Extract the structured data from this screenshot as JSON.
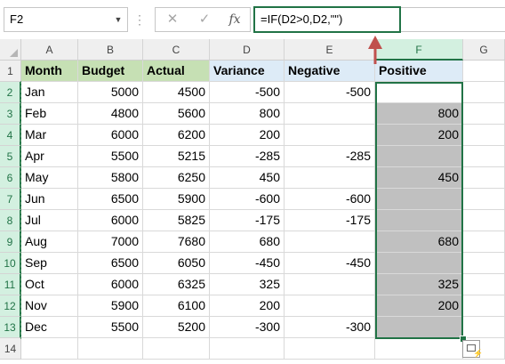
{
  "formula_bar": {
    "name_box": "F2",
    "cancel_glyph": "✕",
    "enter_glyph": "✓",
    "fx_label": "fx",
    "formula": "=IF(D2>0,D2,\"\")"
  },
  "columns": [
    "A",
    "B",
    "C",
    "D",
    "E",
    "F",
    "G"
  ],
  "selected_column": "F",
  "rows": [
    "1",
    "2",
    "3",
    "4",
    "5",
    "6",
    "7",
    "8",
    "9",
    "10",
    "11",
    "12",
    "13",
    "14"
  ],
  "headers": {
    "month": "Month",
    "budget": "Budget",
    "actual": "Actual",
    "variance": "Variance",
    "negative": "Negative",
    "positive": "Positive"
  },
  "table": [
    {
      "month": "Jan",
      "budget": "5000",
      "actual": "4500",
      "variance": "-500",
      "negative": "-500",
      "positive": ""
    },
    {
      "month": "Feb",
      "budget": "4800",
      "actual": "5600",
      "variance": "800",
      "negative": "",
      "positive": "800"
    },
    {
      "month": "Mar",
      "budget": "6000",
      "actual": "6200",
      "variance": "200",
      "negative": "",
      "positive": "200"
    },
    {
      "month": "Apr",
      "budget": "5500",
      "actual": "5215",
      "variance": "-285",
      "negative": "-285",
      "positive": ""
    },
    {
      "month": "May",
      "budget": "5800",
      "actual": "6250",
      "variance": "450",
      "negative": "",
      "positive": "450"
    },
    {
      "month": "Jun",
      "budget": "6500",
      "actual": "5900",
      "variance": "-600",
      "negative": "-600",
      "positive": ""
    },
    {
      "month": "Jul",
      "budget": "6000",
      "actual": "5825",
      "variance": "-175",
      "negative": "-175",
      "positive": ""
    },
    {
      "month": "Aug",
      "budget": "7000",
      "actual": "7680",
      "variance": "680",
      "negative": "",
      "positive": "680"
    },
    {
      "month": "Sep",
      "budget": "6500",
      "actual": "6050",
      "variance": "-450",
      "negative": "-450",
      "positive": ""
    },
    {
      "month": "Oct",
      "budget": "6000",
      "actual": "6325",
      "variance": "325",
      "negative": "",
      "positive": "325"
    },
    {
      "month": "Nov",
      "budget": "5900",
      "actual": "6100",
      "variance": "200",
      "negative": "",
      "positive": "200"
    },
    {
      "month": "Dec",
      "budget": "5500",
      "actual": "5200",
      "variance": "-300",
      "negative": "-300",
      "positive": ""
    }
  ],
  "colors": {
    "header_green": "#c6e0b4",
    "header_blue": "#ddebf7",
    "selection_gray": "#c0c0c0",
    "selection_border": "#217346",
    "arrow_red": "#c0504d"
  },
  "icons": {
    "name_box_dropdown": "chevron-down-icon",
    "more": "vertical-dots-icon",
    "cancel": "close-icon",
    "enter": "check-icon",
    "function": "fx-icon",
    "quick_analysis": "quick-analysis-icon",
    "select_all": "select-all-triangle-icon"
  }
}
